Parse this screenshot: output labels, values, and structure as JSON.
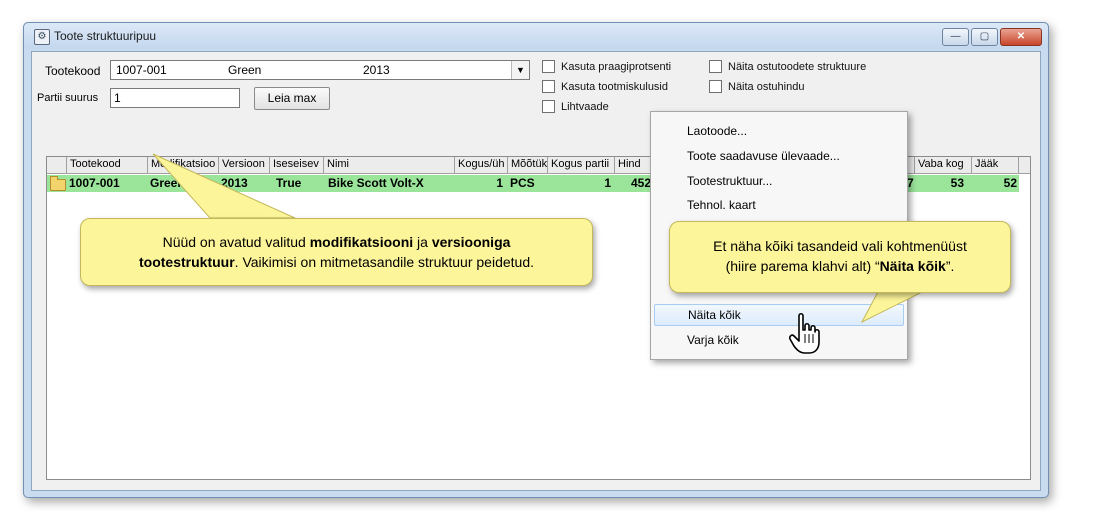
{
  "window": {
    "title": "Toote struktuuripuu",
    "controls": {
      "minimize": "—",
      "maximize": "▢",
      "close": "✕"
    }
  },
  "form": {
    "product_code_label": "Tootekood",
    "product_code_value": "1007-001",
    "modification_value": "Green",
    "version_value": "2013",
    "batch_size_label": "Partii suurus",
    "batch_size_value": "1",
    "find_max_button": "Leia max"
  },
  "checkboxes": [
    {
      "label": "Kasuta praagiprotsenti",
      "checked": false
    },
    {
      "label": "Kasuta tootmiskulusid",
      "checked": false
    },
    {
      "label": "Lihtvaade",
      "checked": false
    },
    {
      "label": "Näita ostutoodete struktuure",
      "checked": false
    },
    {
      "label": "Näita ostuhindu",
      "checked": false
    }
  ],
  "grid": {
    "columns": [
      "Tootekood",
      "Modifikatsioo",
      "Versioon",
      "Iseseisev",
      "Nimi",
      "Kogus/üh",
      "Mõõtük",
      "Kogus partii",
      "Hind",
      "Vaba kog",
      "Jääk"
    ],
    "row": {
      "code": "1007-001",
      "modification": "Green",
      "version": "2013",
      "independent": "True",
      "name": "Bike Scott Volt-X",
      "qty_per_unit": "1",
      "unit": "PCS",
      "qty_batch": "1",
      "price_partial": "452",
      "partial_7": "7",
      "free_qty": "53",
      "balance": "52"
    }
  },
  "context_menu": {
    "items": [
      "Laotoode...",
      "Toote saadavuse ülevaade...",
      "Tootestruktuur...",
      "Tehnol. kaart",
      "Näita kõik",
      "Varja kõik"
    ],
    "highlighted_index": 4
  },
  "callout1": {
    "p1": "Nüüd on avatud valitud ",
    "b1": "modifikatsiooni",
    "p2": " ja ",
    "b2": "versiooniga",
    "b3": "tootestruktuur",
    "p3": ".  Vaikimisi on mitmetasandile struktuur peidetud."
  },
  "callout2": {
    "line1": "Et näha kõiki tasandeid vali kohtmenüüst",
    "p1": "(hiire parema klahvi alt) “",
    "b1": "Näita kõik",
    "p2": "”."
  },
  "colors": {
    "row_highlight": "#9be59b",
    "callout_fill": "#fdf59a",
    "window_frame": "#c9dbee",
    "menu_highlight": "#dcebfb"
  },
  "icons": [
    "app-icon",
    "folder-icon",
    "chevron-down-icon",
    "hand-cursor-icon"
  ]
}
